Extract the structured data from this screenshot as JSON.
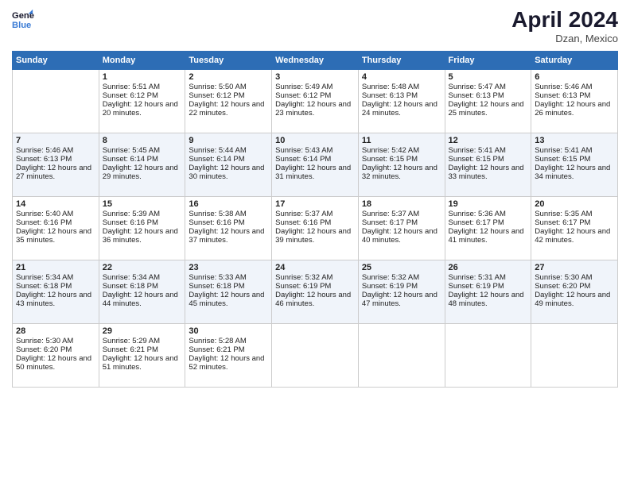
{
  "header": {
    "logo_line1": "General",
    "logo_line2": "Blue",
    "title": "April 2024",
    "location": "Dzan, Mexico"
  },
  "days_of_week": [
    "Sunday",
    "Monday",
    "Tuesday",
    "Wednesday",
    "Thursday",
    "Friday",
    "Saturday"
  ],
  "weeks": [
    [
      {
        "day": "",
        "content": ""
      },
      {
        "day": "1",
        "sunrise": "Sunrise: 5:51 AM",
        "sunset": "Sunset: 6:12 PM",
        "daylight": "Daylight: 12 hours and 20 minutes."
      },
      {
        "day": "2",
        "sunrise": "Sunrise: 5:50 AM",
        "sunset": "Sunset: 6:12 PM",
        "daylight": "Daylight: 12 hours and 22 minutes."
      },
      {
        "day": "3",
        "sunrise": "Sunrise: 5:49 AM",
        "sunset": "Sunset: 6:12 PM",
        "daylight": "Daylight: 12 hours and 23 minutes."
      },
      {
        "day": "4",
        "sunrise": "Sunrise: 5:48 AM",
        "sunset": "Sunset: 6:13 PM",
        "daylight": "Daylight: 12 hours and 24 minutes."
      },
      {
        "day": "5",
        "sunrise": "Sunrise: 5:47 AM",
        "sunset": "Sunset: 6:13 PM",
        "daylight": "Daylight: 12 hours and 25 minutes."
      },
      {
        "day": "6",
        "sunrise": "Sunrise: 5:46 AM",
        "sunset": "Sunset: 6:13 PM",
        "daylight": "Daylight: 12 hours and 26 minutes."
      }
    ],
    [
      {
        "day": "7",
        "sunrise": "Sunrise: 5:46 AM",
        "sunset": "Sunset: 6:13 PM",
        "daylight": "Daylight: 12 hours and 27 minutes."
      },
      {
        "day": "8",
        "sunrise": "Sunrise: 5:45 AM",
        "sunset": "Sunset: 6:14 PM",
        "daylight": "Daylight: 12 hours and 29 minutes."
      },
      {
        "day": "9",
        "sunrise": "Sunrise: 5:44 AM",
        "sunset": "Sunset: 6:14 PM",
        "daylight": "Daylight: 12 hours and 30 minutes."
      },
      {
        "day": "10",
        "sunrise": "Sunrise: 5:43 AM",
        "sunset": "Sunset: 6:14 PM",
        "daylight": "Daylight: 12 hours and 31 minutes."
      },
      {
        "day": "11",
        "sunrise": "Sunrise: 5:42 AM",
        "sunset": "Sunset: 6:15 PM",
        "daylight": "Daylight: 12 hours and 32 minutes."
      },
      {
        "day": "12",
        "sunrise": "Sunrise: 5:41 AM",
        "sunset": "Sunset: 6:15 PM",
        "daylight": "Daylight: 12 hours and 33 minutes."
      },
      {
        "day": "13",
        "sunrise": "Sunrise: 5:41 AM",
        "sunset": "Sunset: 6:15 PM",
        "daylight": "Daylight: 12 hours and 34 minutes."
      }
    ],
    [
      {
        "day": "14",
        "sunrise": "Sunrise: 5:40 AM",
        "sunset": "Sunset: 6:16 PM",
        "daylight": "Daylight: 12 hours and 35 minutes."
      },
      {
        "day": "15",
        "sunrise": "Sunrise: 5:39 AM",
        "sunset": "Sunset: 6:16 PM",
        "daylight": "Daylight: 12 hours and 36 minutes."
      },
      {
        "day": "16",
        "sunrise": "Sunrise: 5:38 AM",
        "sunset": "Sunset: 6:16 PM",
        "daylight": "Daylight: 12 hours and 37 minutes."
      },
      {
        "day": "17",
        "sunrise": "Sunrise: 5:37 AM",
        "sunset": "Sunset: 6:16 PM",
        "daylight": "Daylight: 12 hours and 39 minutes."
      },
      {
        "day": "18",
        "sunrise": "Sunrise: 5:37 AM",
        "sunset": "Sunset: 6:17 PM",
        "daylight": "Daylight: 12 hours and 40 minutes."
      },
      {
        "day": "19",
        "sunrise": "Sunrise: 5:36 AM",
        "sunset": "Sunset: 6:17 PM",
        "daylight": "Daylight: 12 hours and 41 minutes."
      },
      {
        "day": "20",
        "sunrise": "Sunrise: 5:35 AM",
        "sunset": "Sunset: 6:17 PM",
        "daylight": "Daylight: 12 hours and 42 minutes."
      }
    ],
    [
      {
        "day": "21",
        "sunrise": "Sunrise: 5:34 AM",
        "sunset": "Sunset: 6:18 PM",
        "daylight": "Daylight: 12 hours and 43 minutes."
      },
      {
        "day": "22",
        "sunrise": "Sunrise: 5:34 AM",
        "sunset": "Sunset: 6:18 PM",
        "daylight": "Daylight: 12 hours and 44 minutes."
      },
      {
        "day": "23",
        "sunrise": "Sunrise: 5:33 AM",
        "sunset": "Sunset: 6:18 PM",
        "daylight": "Daylight: 12 hours and 45 minutes."
      },
      {
        "day": "24",
        "sunrise": "Sunrise: 5:32 AM",
        "sunset": "Sunset: 6:19 PM",
        "daylight": "Daylight: 12 hours and 46 minutes."
      },
      {
        "day": "25",
        "sunrise": "Sunrise: 5:32 AM",
        "sunset": "Sunset: 6:19 PM",
        "daylight": "Daylight: 12 hours and 47 minutes."
      },
      {
        "day": "26",
        "sunrise": "Sunrise: 5:31 AM",
        "sunset": "Sunset: 6:19 PM",
        "daylight": "Daylight: 12 hours and 48 minutes."
      },
      {
        "day": "27",
        "sunrise": "Sunrise: 5:30 AM",
        "sunset": "Sunset: 6:20 PM",
        "daylight": "Daylight: 12 hours and 49 minutes."
      }
    ],
    [
      {
        "day": "28",
        "sunrise": "Sunrise: 5:30 AM",
        "sunset": "Sunset: 6:20 PM",
        "daylight": "Daylight: 12 hours and 50 minutes."
      },
      {
        "day": "29",
        "sunrise": "Sunrise: 5:29 AM",
        "sunset": "Sunset: 6:21 PM",
        "daylight": "Daylight: 12 hours and 51 minutes."
      },
      {
        "day": "30",
        "sunrise": "Sunrise: 5:28 AM",
        "sunset": "Sunset: 6:21 PM",
        "daylight": "Daylight: 12 hours and 52 minutes."
      },
      {
        "day": "",
        "content": ""
      },
      {
        "day": "",
        "content": ""
      },
      {
        "day": "",
        "content": ""
      },
      {
        "day": "",
        "content": ""
      }
    ]
  ]
}
